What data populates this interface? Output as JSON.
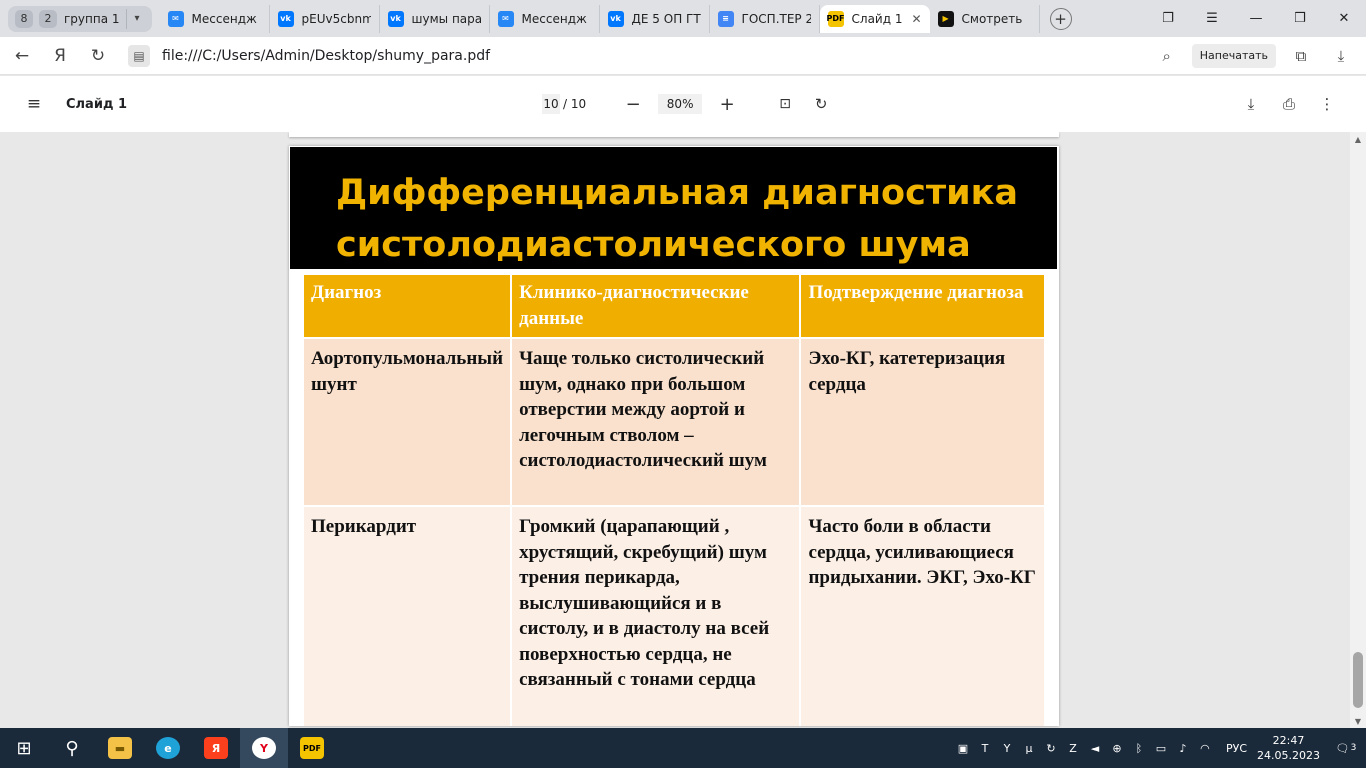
{
  "tabs": {
    "group_badge": "8",
    "group_count": "2",
    "group_name": "группа 1",
    "items": [
      {
        "label": "Мессендж",
        "icon": "messenger-icon"
      },
      {
        "label": "pEUv5cbnm",
        "icon": "vk-icon"
      },
      {
        "label": "шумы пара",
        "icon": "vk-icon"
      },
      {
        "label": "Мессендж",
        "icon": "messenger-icon"
      },
      {
        "label": "ДЕ 5 ОП ГТ",
        "icon": "vk-icon"
      },
      {
        "label": "ГОСП.ТЕР 2",
        "icon": "docs-icon"
      },
      {
        "label": "Слайд 1",
        "icon": "pdf-icon",
        "active": true
      },
      {
        "label": "Смотреть",
        "icon": "play-icon"
      }
    ]
  },
  "address": {
    "url": "file:///C:/Users/Admin/Desktop/shumy_para.pdf",
    "print_label": "Напечатать"
  },
  "pdf_toolbar": {
    "doc_title": "Слайд 1",
    "current_page": "10",
    "total_pages": "/ 10",
    "zoom": "80%"
  },
  "slide": {
    "title": "Дифференциальная диагностика систолодиастолического шума",
    "table": {
      "headers": [
        "Диагноз",
        "Клинико-диагностические данные",
        "Подтверждение диагноза"
      ],
      "rows": [
        [
          "Аортопульмональный  шунт",
          "Чаще только систолический шум, однако при большом отверстии между аортой и легочным стволом – систолодиастолический шум",
          "Эхо-КГ,  катетеризация сердца"
        ],
        [
          "Перикардит",
          "Громкий (царапающий , хрустящий, скребущий) шум трения перикарда, выслушивающийся и в систолу, и в диастолу на всей поверхностью сердца, не связанный с тонами сердца",
          "Часто боли в области сердца, усиливающиеся придыхании. ЭКГ, Эхо-КГ"
        ]
      ]
    }
  },
  "taskbar": {
    "lang": "РУС",
    "time": "22:47",
    "date": "24.05.2023",
    "notifications": "3"
  },
  "colors": {
    "title_yellow": "#f0b400",
    "header_orange": "#f0ae00",
    "row1_bg": "#fae1cd",
    "row2_bg": "#fcefe6"
  }
}
